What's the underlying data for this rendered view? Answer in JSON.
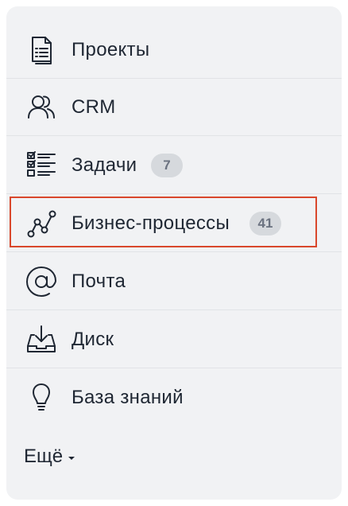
{
  "menu": {
    "items": [
      {
        "label": "Проекты",
        "icon": "document-icon"
      },
      {
        "label": "CRM",
        "icon": "users-icon"
      },
      {
        "label": "Задачи",
        "icon": "tasks-checklist-icon",
        "badge": "7"
      },
      {
        "label": "Бизнес-процессы",
        "icon": "workflow-icon",
        "badge": "41",
        "highlighted": true
      },
      {
        "label": "Почта",
        "icon": "at-sign-icon"
      },
      {
        "label": "Диск",
        "icon": "disk-download-icon"
      },
      {
        "label": "База знаний",
        "icon": "lightbulb-icon"
      }
    ],
    "more_label": "Ещё"
  },
  "colors": {
    "panel_background": "#f1f2f4",
    "text": "#1f2733",
    "badge_background": "#d6d9dd",
    "badge_text": "#6b7280",
    "highlight_border": "#d9472b"
  }
}
